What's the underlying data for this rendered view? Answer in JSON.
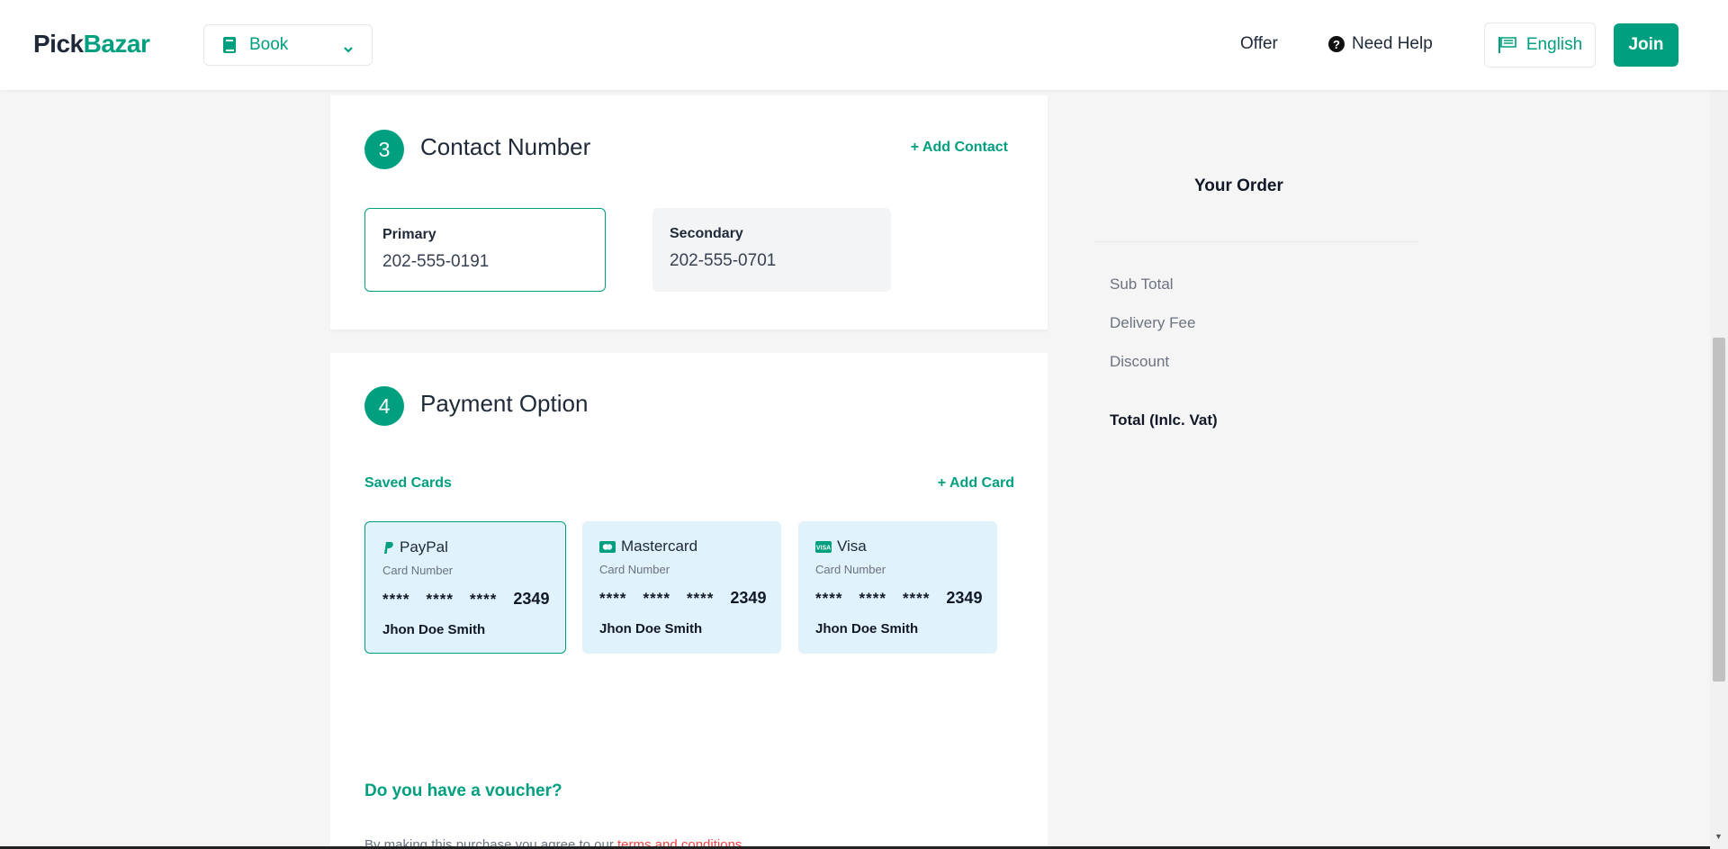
{
  "header": {
    "logo_part1": "Pick",
    "logo_part2": "Bazar",
    "type_selector": "Book",
    "nav_offer": "Offer",
    "nav_help": "Need Help",
    "language": "English",
    "join": "Join"
  },
  "contact": {
    "step": "3",
    "title": "Contact Number",
    "add_label": "+ Add Contact",
    "primary": {
      "label": "Primary",
      "value": "202-555-0191"
    },
    "secondary": {
      "label": "Secondary",
      "value": "202-555-0701"
    }
  },
  "payment": {
    "step": "4",
    "title": "Payment Option",
    "saved_cards": "Saved Cards",
    "add_card": "+ Add Card",
    "cards": [
      {
        "brand": "PayPal",
        "number_label": "Card Number",
        "mask1": "****",
        "mask2": "****",
        "mask3": "****",
        "last4": "2349",
        "holder": "Jhon Doe Smith",
        "icon": "paypal-icon"
      },
      {
        "brand": "Mastercard",
        "number_label": "Card Number",
        "mask1": "****",
        "mask2": "****",
        "mask3": "****",
        "last4": "2349",
        "holder": "Jhon Doe Smith",
        "icon": "mastercard-icon"
      },
      {
        "brand": "Visa",
        "number_label": "Card Number",
        "mask1": "****",
        "mask2": "****",
        "mask3": "****",
        "last4": "2349",
        "holder": "Jhon Doe Smith",
        "icon": "visa-icon"
      }
    ],
    "voucher": "Do you have a voucher?",
    "terms_prefix": "By making this purchase you agree to our ",
    "terms_link": "terms and conditions."
  },
  "order": {
    "title": "Your Order",
    "sub_total": "Sub Total",
    "delivery_fee": "Delivery Fee",
    "discount": "Discount",
    "total": "Total (Inlc. Vat)"
  },
  "colors": {
    "accent": "#009f7f",
    "card_bg": "#e0f2fa",
    "link_red": "#ef4444"
  }
}
